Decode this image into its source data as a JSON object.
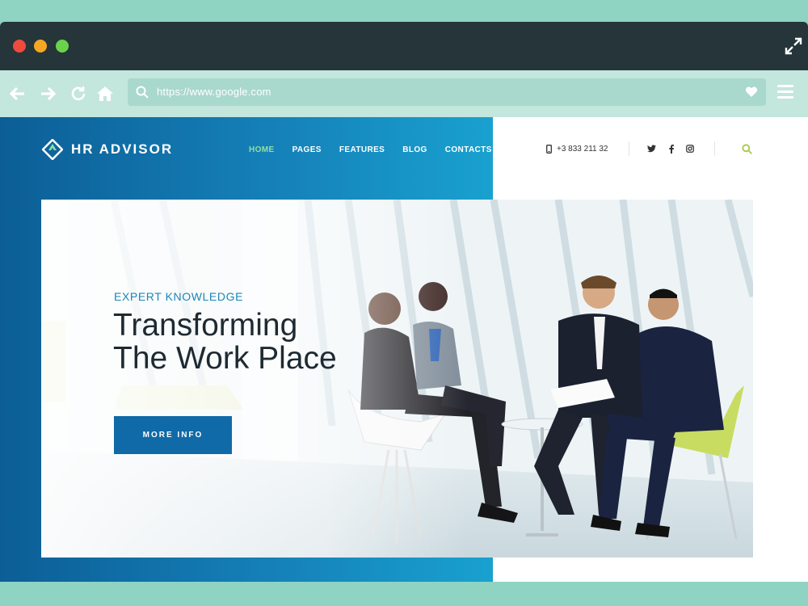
{
  "browser": {
    "url": "https://www.google.com",
    "colors": {
      "titlebar": "#25353a",
      "toolbar": "#c3e6dd",
      "frame": "#8fd3c3"
    },
    "icons": [
      "back-arrow-icon",
      "forward-arrow-icon",
      "reload-icon",
      "home-icon",
      "search-icon",
      "heart-icon",
      "hamburger-menu-icon",
      "expand-icon"
    ]
  },
  "site": {
    "logo": "HR ADVISOR",
    "nav": [
      {
        "label": "HOME",
        "active": true
      },
      {
        "label": "PAGES",
        "active": false
      },
      {
        "label": "FEATURES",
        "active": false
      },
      {
        "label": "BLOG",
        "active": false
      },
      {
        "label": "CONTACTS",
        "active": false
      }
    ],
    "phone": "+3 833 211 32",
    "social": [
      "twitter-icon",
      "facebook-icon",
      "instagram-icon"
    ],
    "colors": {
      "brand_blue": "#0f6aa7",
      "accent_green": "#8fe0a0",
      "search": "#a8c84a"
    }
  },
  "hero": {
    "subtitle": "EXPERT KNOWLEDGE",
    "title_line1": "Transforming",
    "title_line2": "The Work Place",
    "button": "MORE INFO"
  }
}
